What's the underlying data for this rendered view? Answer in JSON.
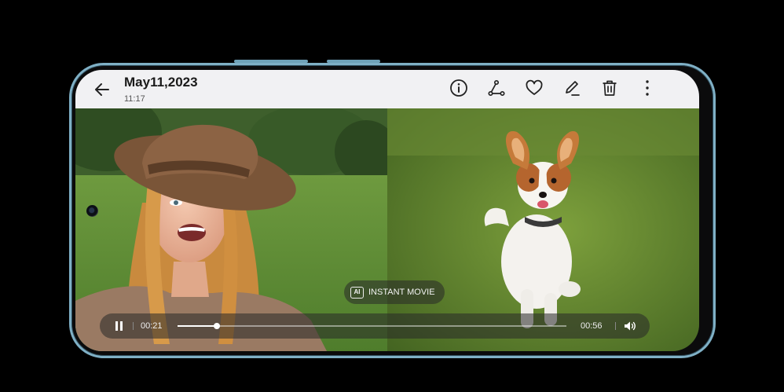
{
  "header": {
    "date": "May11,2023",
    "time": "11:17"
  },
  "actions": {
    "icons": [
      "back-arrow-icon",
      "info-icon",
      "share-icon",
      "heart-icon",
      "edit-icon",
      "delete-icon",
      "more-icon"
    ]
  },
  "chip": {
    "icon_text": "AI",
    "label": "INSTANT MOVIE"
  },
  "player": {
    "current_time": "00:21",
    "duration": "00:56",
    "progress_fraction": 0.1
  },
  "colors": {
    "frame": "#7fb0c6",
    "topbar": "#f1f1f3",
    "icon": "#222222"
  }
}
